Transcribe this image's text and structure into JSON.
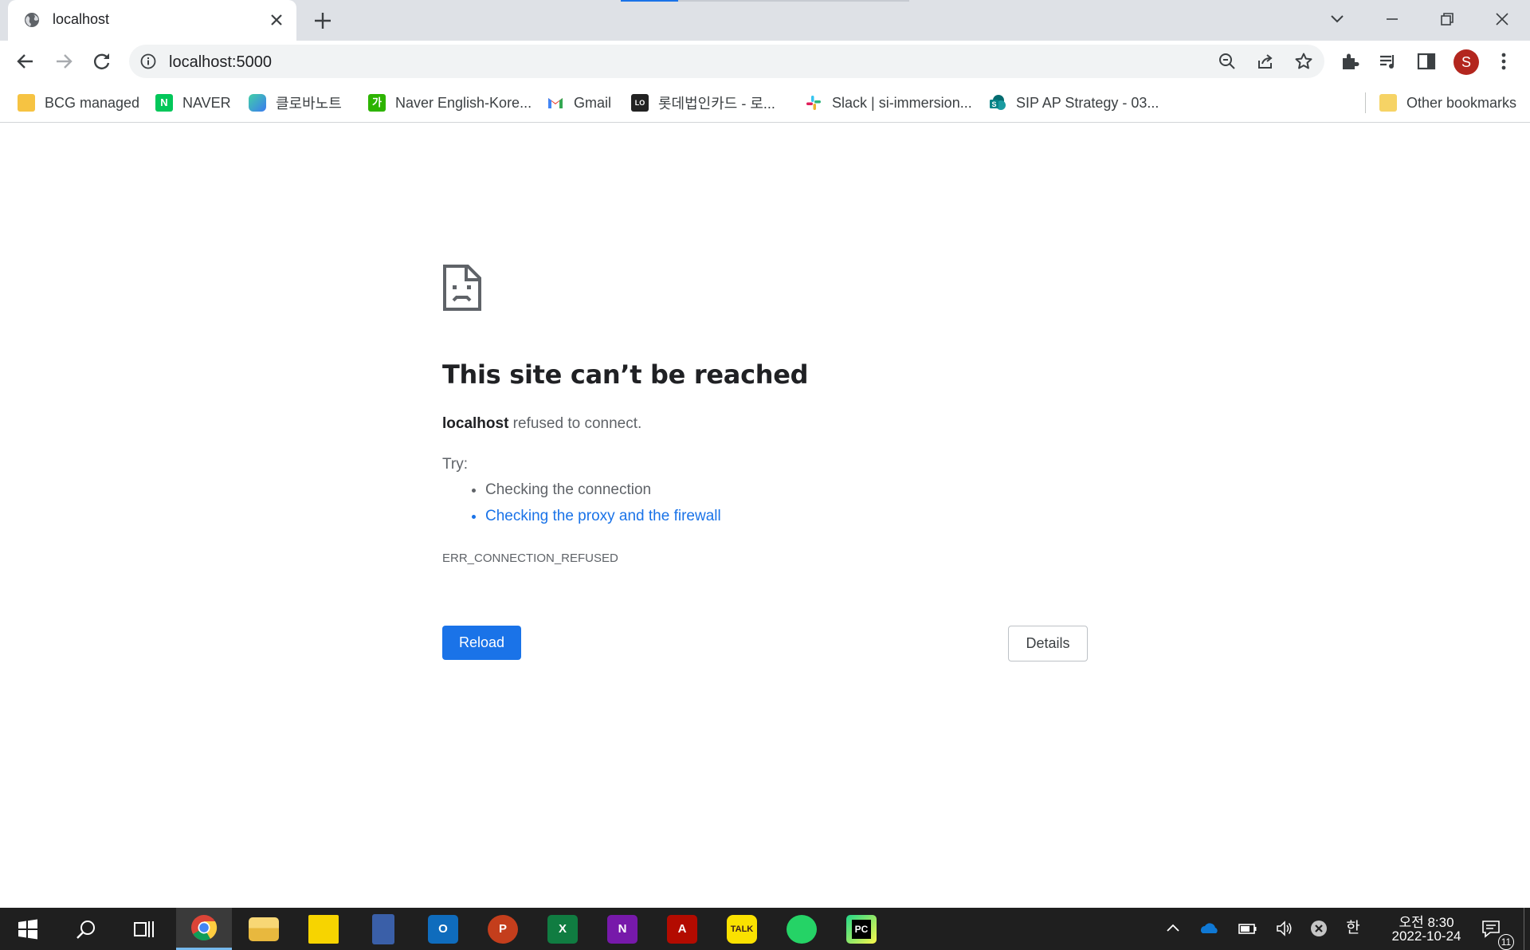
{
  "tab": {
    "title": "localhost"
  },
  "omnibox": {
    "url": "localhost:5000"
  },
  "profile": {
    "initial": "S",
    "color": "#b3261e"
  },
  "bookmarks": [
    {
      "label": "BCG managed",
      "icon": "folder-icon"
    },
    {
      "label": "NAVER",
      "icon": "naver-icon"
    },
    {
      "label": "클로바노트",
      "icon": "clova-note-icon"
    },
    {
      "label": "Naver English-Kore...",
      "icon": "naver-dict-icon"
    },
    {
      "label": "Gmail",
      "icon": "gmail-icon"
    },
    {
      "label": "롯데법인카드 - 로...",
      "icon": "lotte-card-icon"
    },
    {
      "label": "Slack | si-immersion...",
      "icon": "slack-icon"
    },
    {
      "label": "SIP AP Strategy - 03...",
      "icon": "sharepoint-icon"
    }
  ],
  "other_bookmarks": "Other bookmarks",
  "error": {
    "title": "This site can’t be reached",
    "host": "localhost",
    "summary_rest": " refused to connect.",
    "try_label": "Try:",
    "suggestions": [
      "Checking the connection",
      "Checking the proxy and the firewall"
    ],
    "code": "ERR_CONNECTION_REFUSED",
    "reload_label": "Reload",
    "details_label": "Details"
  },
  "taskbar": {
    "apps": [
      "start",
      "search",
      "task-view",
      "chrome",
      "file-explorer",
      "sticky-notes",
      "calculator",
      "outlook",
      "powerpoint",
      "excel",
      "onenote",
      "acrobat",
      "kakaotalk",
      "whatsapp",
      "pycharm"
    ],
    "ime": "한",
    "time": "오전 8:30",
    "date": "2022-10-24",
    "notification_count": "11"
  },
  "colors": {
    "accent": "#1a73e8",
    "tabstrip": "#dee1e6",
    "taskbar": "#1f1f1f"
  }
}
